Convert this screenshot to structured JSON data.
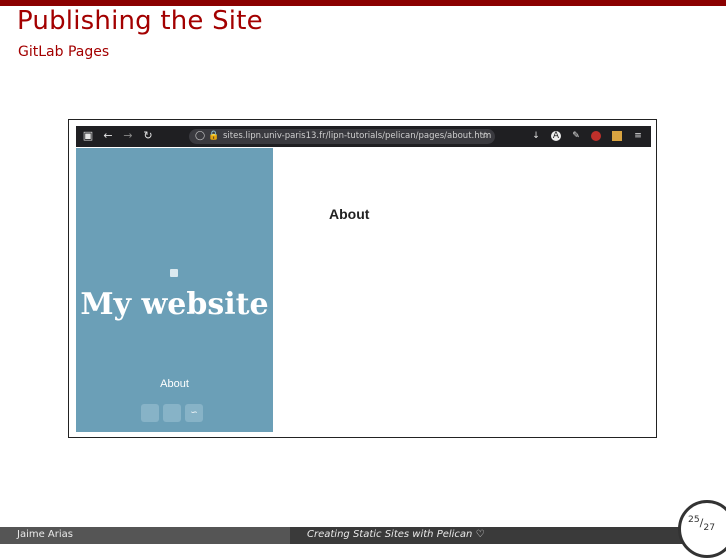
{
  "slide": {
    "title": "Publishing the Site",
    "subtitle": "GitLab Pages"
  },
  "browser": {
    "url": "sites.lipn.univ-paris13.fr/lipn-tutorials/pelican/pages/about.htm",
    "nav_icons": [
      "sidebar-icon",
      "back-icon",
      "forward-icon",
      "reload-icon"
    ],
    "ext_icons": [
      "download-icon",
      "account-icon",
      "reader-icon",
      "extension-icon",
      "grid-icon",
      "menu-icon"
    ]
  },
  "site": {
    "title": "My website",
    "nav": {
      "about": "About"
    },
    "social_icons": [
      "social-icon-1",
      "social-icon-2",
      "rss-icon"
    ]
  },
  "page": {
    "heading": "About"
  },
  "footer": {
    "author": "Jaime Arias",
    "title": "Creating Static Sites with Pelican ♡",
    "page_current": "25",
    "page_total": "27"
  }
}
